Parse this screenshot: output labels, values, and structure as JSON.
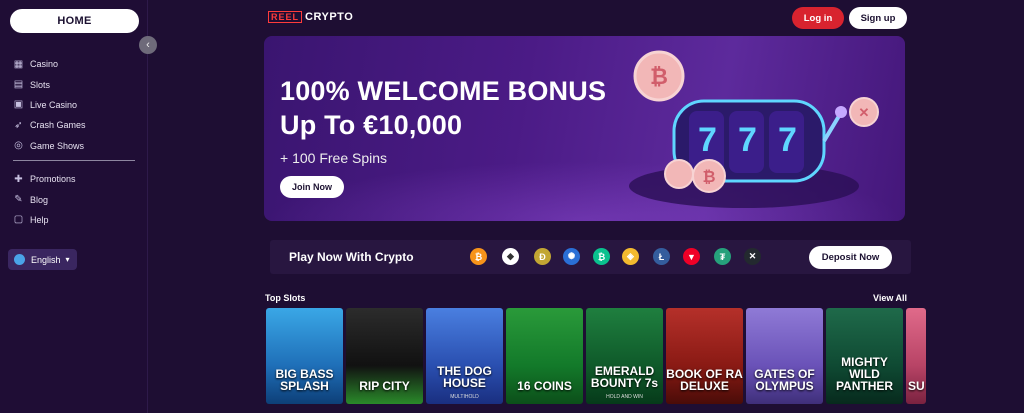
{
  "sidebar": {
    "home_label": "HOME",
    "collapse_icon": "chevron-left-icon",
    "items": [
      {
        "label": "Casino",
        "icon": "casino-icon"
      },
      {
        "label": "Slots",
        "icon": "slots-icon"
      },
      {
        "label": "Live Casino",
        "icon": "live-casino-icon"
      },
      {
        "label": "Crash Games",
        "icon": "rocket-icon"
      },
      {
        "label": "Game Shows",
        "icon": "game-shows-icon"
      }
    ],
    "secondary_items": [
      {
        "label": "Promotions",
        "icon": "gift-icon"
      },
      {
        "label": "Blog",
        "icon": "blog-icon"
      },
      {
        "label": "Help",
        "icon": "help-icon"
      }
    ],
    "language": "English"
  },
  "header": {
    "logo_reel": "REEL",
    "logo_crypto": "CRYPTO",
    "login_label": "Log in",
    "signup_label": "Sign up"
  },
  "banner": {
    "title_line1": "100% WELCOME BONUS",
    "title_line2": "Up To €10,000",
    "subtitle": "+ 100 Free Spins",
    "cta_label": "Join Now",
    "reel_symbols": [
      "7",
      "7",
      "7"
    ]
  },
  "crypto_bar": {
    "label": "Play Now With Crypto",
    "deposit_label": "Deposit Now",
    "coins": [
      {
        "name": "bitcoin-icon",
        "glyph": "₿",
        "color": "#f7931a"
      },
      {
        "name": "ethereum-icon",
        "glyph": "◆",
        "color": "#ffffff"
      },
      {
        "name": "dogecoin-icon",
        "glyph": "Ð",
        "color": "#c2a633"
      },
      {
        "name": "cardano-icon",
        "glyph": "✺",
        "color": "#2a6fd6"
      },
      {
        "name": "bitcoin-cash-icon",
        "glyph": "₿",
        "color": "#0ac18e"
      },
      {
        "name": "binance-icon",
        "glyph": "◈",
        "color": "#f3ba2f"
      },
      {
        "name": "litecoin-icon",
        "glyph": "Ł",
        "color": "#345d9d"
      },
      {
        "name": "tron-icon",
        "glyph": "▼",
        "color": "#ef0027"
      },
      {
        "name": "tether-icon",
        "glyph": "₮",
        "color": "#26a17b"
      },
      {
        "name": "ripple-icon",
        "glyph": "✕",
        "color": "#23292f"
      }
    ]
  },
  "top_slots": {
    "title": "Top Slots",
    "view_all_label": "View All",
    "games": [
      {
        "name": "BIG BASS SPLASH",
        "sub": "",
        "bg": "linear-gradient(180deg,#3aa7e6,#1f6fb8 60%,#0d3f78)"
      },
      {
        "name": "RIP CITY",
        "sub": "",
        "bg": "linear-gradient(180deg,#2c2c2c,#111 60%,#2a8a2a)"
      },
      {
        "name": "THE DOG HOUSE",
        "sub": "MULTIHOLD",
        "bg": "linear-gradient(180deg,#4a7fe0,#2a4fb0 60%,#1a2f80)"
      },
      {
        "name": "16 COINS",
        "sub": "",
        "bg": "linear-gradient(180deg,#2a9a3a,#137a2a 60%,#0c4f1a)"
      },
      {
        "name": "EMERALD BOUNTY 7s",
        "sub": "HOLD AND WIN",
        "bg": "linear-gradient(180deg,#1f7f3f,#0f5a2a 60%,#063a1a)"
      },
      {
        "name": "BOOK OF RA DELUXE",
        "sub": "",
        "bg": "linear-gradient(180deg,#b5302a,#8a1a14 60%,#4a0c08)"
      },
      {
        "name": "GATES OF OLYMPUS",
        "sub": "",
        "bg": "linear-gradient(180deg,#8f7ad6,#6a52b8 60%,#3f2f7a)"
      },
      {
        "name": "MIGHTY WILD PANTHER",
        "sub": "",
        "bg": "linear-gradient(180deg,#1f6a4a,#0f4a33 60%,#072a1d)"
      },
      {
        "name": "SU",
        "sub": "",
        "bg": "linear-gradient(180deg,#e06a8a,#b84466 60%,#7a2240)"
      }
    ]
  }
}
